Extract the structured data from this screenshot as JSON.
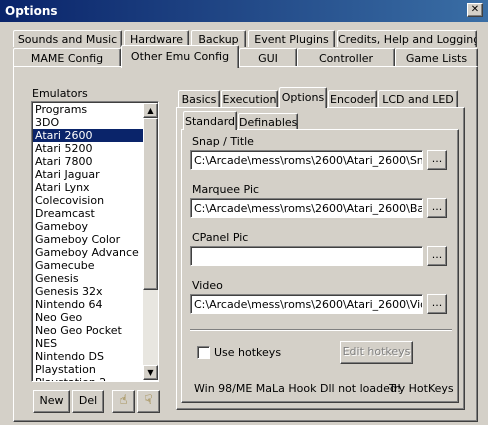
{
  "window": {
    "title": "Options",
    "close_glyph": "✕"
  },
  "tabs_row1": [
    "Sounds and Music",
    "Hardware",
    "Backup",
    "Event Plugins",
    "Credits, Help and Logging"
  ],
  "tabs_row2": [
    "MAME Config",
    "Other Emu Config",
    "GUI",
    "Controller",
    "Game Lists"
  ],
  "active_tab_row2": "Other Emu Config",
  "emulators": {
    "label": "Emulators",
    "selected": "Atari 2600",
    "items": [
      "Programs",
      "3DO",
      "Atari 2600",
      "Atari 5200",
      "Atari 7800",
      "Atari Jaguar",
      "Atari Lynx",
      "Colecovision",
      "Dreamcast",
      "Gameboy",
      "Gameboy Color",
      "Gameboy Advance",
      "Gamecube",
      "Genesis",
      "Genesis 32x",
      "Nintendo 64",
      "Neo Geo",
      "Neo Geo Pocket",
      "NES",
      "Nintendo DS",
      "Playstation",
      "Playstation 2"
    ],
    "new_label": "New",
    "del_label": "Del",
    "up_icon": "hand-up-icon",
    "down_icon": "hand-down-icon"
  },
  "inner_tabs": [
    "Basics",
    "Execution",
    "Options",
    "Encoder",
    "LCD and LED"
  ],
  "active_inner_tab": "Options",
  "sub_tabs": [
    "Standard",
    "Definables"
  ],
  "active_sub_tab": "Standard",
  "fields": {
    "snap_label": "Snap / Title",
    "snap_value": "C:\\Arcade\\mess\\roms\\2600\\Atari_2600\\Snap",
    "marquee_label": "Marquee Pic",
    "marquee_value": "C:\\Arcade\\mess\\roms\\2600\\Atari_2600\\Banne",
    "cpanel_label": "CPanel Pic",
    "cpanel_value": "",
    "video_label": "Video",
    "video_value": "C:\\Arcade\\mess\\roms\\2600\\Atari_2600\\Video_",
    "browse_label": "..."
  },
  "hotkeys": {
    "use_label": "Use hotkeys",
    "checked": false,
    "edit_label": "Edit hotkeys",
    "status": "Win 98/ME MaLa Hook Dll not loaded!",
    "try_label": "Try HotKeys"
  },
  "colors": {
    "titlebar": "#0a246a",
    "selection": "#0a246a",
    "face": "#d4d0c8"
  }
}
